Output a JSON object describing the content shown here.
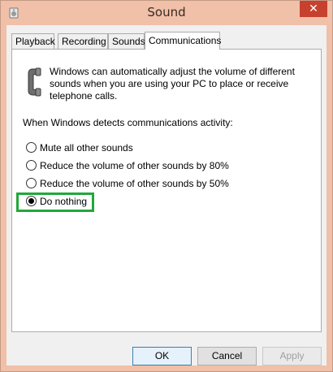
{
  "window": {
    "title": "Sound",
    "close_label": "✕"
  },
  "tabs": [
    {
      "label": "Playback",
      "active": false
    },
    {
      "label": "Recording",
      "active": false
    },
    {
      "label": "Sounds",
      "active": false
    },
    {
      "label": "Communications",
      "active": true
    }
  ],
  "communications": {
    "description": "Windows can automatically adjust the volume of different sounds when you are using your PC to place or receive telephone calls.",
    "prompt": "When Windows detects communications activity:",
    "options": [
      {
        "label": "Mute all other sounds",
        "checked": false
      },
      {
        "label": "Reduce the volume of other sounds by 80%",
        "checked": false
      },
      {
        "label": "Reduce the volume of other sounds by 50%",
        "checked": false
      },
      {
        "label": "Do nothing",
        "checked": true
      }
    ]
  },
  "buttons": {
    "ok": "OK",
    "cancel": "Cancel",
    "apply": "Apply"
  },
  "colors": {
    "titlebar": "#f0c0a8",
    "close": "#c7412f",
    "highlight": "#22a83a"
  }
}
